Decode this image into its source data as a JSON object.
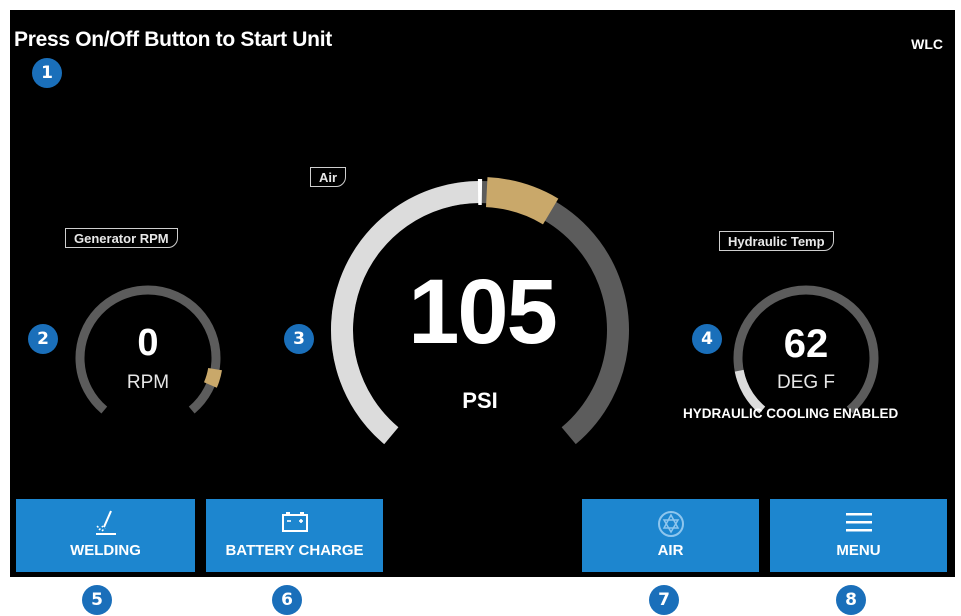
{
  "status_message": "Press On/Off Button to Start Unit",
  "unit_code": "WLC",
  "gauges": {
    "generator": {
      "tag": "Generator RPM",
      "value": "0",
      "unit": "RPM",
      "level": 0,
      "marker_level": 0.88
    },
    "air": {
      "tag": "Air",
      "value": "105",
      "unit": "PSI",
      "level": 0.5,
      "marker_level": 0.56
    },
    "hydraulic": {
      "tag": "Hydraulic Temp",
      "value": "62",
      "unit": "DEG F",
      "note": "HYDRAULIC COOLING ENABLED",
      "level": 0.05
    }
  },
  "buttons": {
    "welding": {
      "label": "WELDING",
      "icon": "welding-icon"
    },
    "battery": {
      "label": "BATTERY CHARGE",
      "icon": "battery-icon"
    },
    "air": {
      "label": "AIR",
      "icon": "air-icon"
    },
    "menu": {
      "label": "MENU",
      "icon": "menu-icon"
    }
  },
  "markers": [
    "1",
    "2",
    "3",
    "4",
    "5",
    "6",
    "7",
    "8"
  ],
  "colors": {
    "button_blue": "#1d86cf",
    "marker_blue": "#1a6fba",
    "arc_track": "#5c5c5c",
    "arc_fill": "#dcdcdc",
    "arc_accent": "#c9a86a",
    "background": "#000000"
  }
}
